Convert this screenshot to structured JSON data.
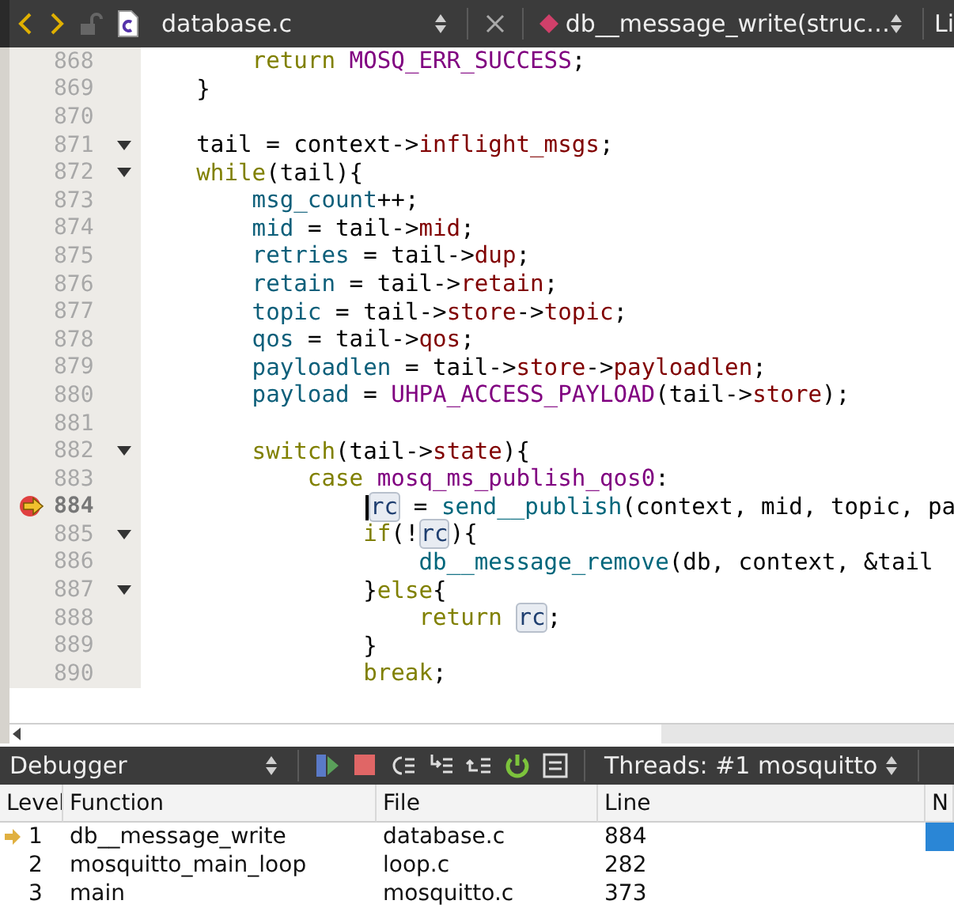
{
  "editor_toolbar": {
    "file": "database.c",
    "function": "db__message_write(struc…",
    "cut_label": "Li"
  },
  "code": [
    {
      "number": "868",
      "fold": false,
      "current": false,
      "tokens": [
        {
          "kind": "kw",
          "text": "        return"
        },
        {
          "kind": "macro",
          "text": " MOSQ_ERR_SUCCESS"
        },
        {
          "kind": "plain",
          "text": ";"
        }
      ]
    },
    {
      "number": "869",
      "fold": false,
      "current": false,
      "tokens": [
        {
          "kind": "plain",
          "text": "    }"
        }
      ]
    },
    {
      "number": "870",
      "fold": false,
      "current": false
    },
    {
      "number": "871",
      "fold": true,
      "current": false,
      "tokens": [
        {
          "kind": "plain",
          "text": "    tail = context->"
        },
        {
          "kind": "field",
          "text": "inflight_msgs"
        },
        {
          "kind": "plain",
          "text": ";"
        }
      ]
    },
    {
      "number": "872",
      "fold": true,
      "current": false,
      "tokens": [
        {
          "kind": "kw",
          "text": "    while"
        },
        {
          "kind": "plain",
          "text": "(tail){"
        }
      ]
    },
    {
      "number": "873",
      "fold": false,
      "current": false,
      "tokens": [
        {
          "kind": "var",
          "text": "        msg_count"
        },
        {
          "kind": "plain",
          "text": "++;"
        }
      ]
    },
    {
      "number": "874",
      "fold": false,
      "current": false,
      "tokens": [
        {
          "kind": "var",
          "text": "        mid"
        },
        {
          "kind": "plain",
          "text": " = tail->"
        },
        {
          "kind": "field",
          "text": "mid"
        },
        {
          "kind": "plain",
          "text": ";"
        }
      ]
    },
    {
      "number": "875",
      "fold": false,
      "current": false,
      "tokens": [
        {
          "kind": "var",
          "text": "        retries"
        },
        {
          "kind": "plain",
          "text": " = tail->"
        },
        {
          "kind": "field",
          "text": "dup"
        },
        {
          "kind": "plain",
          "text": ";"
        }
      ]
    },
    {
      "number": "876",
      "fold": false,
      "current": false,
      "tokens": [
        {
          "kind": "var",
          "text": "        retain"
        },
        {
          "kind": "plain",
          "text": " = tail->"
        },
        {
          "kind": "field",
          "text": "retain"
        },
        {
          "kind": "plain",
          "text": ";"
        }
      ]
    },
    {
      "number": "877",
      "fold": false,
      "current": false,
      "tokens": [
        {
          "kind": "var",
          "text": "        topic"
        },
        {
          "kind": "plain",
          "text": " = tail->"
        },
        {
          "kind": "field",
          "text": "store"
        },
        {
          "kind": "plain",
          "text": "->"
        },
        {
          "kind": "field",
          "text": "topic"
        },
        {
          "kind": "plain",
          "text": ";"
        }
      ]
    },
    {
      "number": "878",
      "fold": false,
      "current": false,
      "tokens": [
        {
          "kind": "var",
          "text": "        qos"
        },
        {
          "kind": "plain",
          "text": " = tail->"
        },
        {
          "kind": "field",
          "text": "qos"
        },
        {
          "kind": "plain",
          "text": ";"
        }
      ]
    },
    {
      "number": "879",
      "fold": false,
      "current": false,
      "tokens": [
        {
          "kind": "var",
          "text": "        payloadlen"
        },
        {
          "kind": "plain",
          "text": " = tail->"
        },
        {
          "kind": "field",
          "text": "store"
        },
        {
          "kind": "plain",
          "text": "->"
        },
        {
          "kind": "field",
          "text": "payloadlen"
        },
        {
          "kind": "plain",
          "text": ";"
        }
      ]
    },
    {
      "number": "880",
      "fold": false,
      "current": false,
      "tokens": [
        {
          "kind": "var",
          "text": "        payload"
        },
        {
          "kind": "plain",
          "text": " = "
        },
        {
          "kind": "macro",
          "text": "UHPA_ACCESS_PAYLOAD"
        },
        {
          "kind": "plain",
          "text": "(tail->"
        },
        {
          "kind": "field",
          "text": "store"
        },
        {
          "kind": "plain",
          "text": ");"
        }
      ]
    },
    {
      "number": "881",
      "fold": false,
      "current": false
    },
    {
      "number": "882",
      "fold": true,
      "current": false,
      "tokens": [
        {
          "kind": "kw",
          "text": "        switch"
        },
        {
          "kind": "plain",
          "text": "(tail->"
        },
        {
          "kind": "field",
          "text": "state"
        },
        {
          "kind": "plain",
          "text": "){"
        }
      ]
    },
    {
      "number": "883",
      "fold": false,
      "current": false,
      "tokens": [
        {
          "kind": "kw",
          "text": "            case"
        },
        {
          "kind": "macro",
          "text": " mosq_ms_publish_qos0"
        },
        {
          "kind": "plain",
          "text": ":"
        }
      ]
    },
    {
      "number": "884",
      "fold": false,
      "current": true,
      "tokens": [
        {
          "kind": "ref",
          "text": "rc"
        },
        {
          "kind": "plain",
          "text": " = "
        },
        {
          "kind": "func",
          "text": "send__publish"
        },
        {
          "kind": "plain",
          "text": "(context, mid, topic, pa"
        }
      ]
    },
    {
      "number": "885",
      "fold": true,
      "current": false,
      "tokens": [
        {
          "kind": "kw",
          "text": "                if"
        },
        {
          "kind": "plain",
          "text": "(!"
        },
        {
          "kind": "ref",
          "text": "rc"
        },
        {
          "kind": "plain",
          "text": "){"
        }
      ]
    },
    {
      "number": "886",
      "fold": false,
      "current": false,
      "tokens": [
        {
          "kind": "func",
          "text": "                    db__message_remove"
        },
        {
          "kind": "plain",
          "text": "(db, context, &tail"
        }
      ]
    },
    {
      "number": "887",
      "fold": true,
      "current": false,
      "tokens": [
        {
          "kind": "plain",
          "text": "                }"
        },
        {
          "kind": "kw",
          "text": "else"
        },
        {
          "kind": "plain",
          "text": "{"
        }
      ]
    },
    {
      "number": "888",
      "fold": false,
      "current": false,
      "tokens": [
        {
          "kind": "kw",
          "text": "                    return "
        },
        {
          "kind": "ref",
          "text": "rc"
        },
        {
          "kind": "plain",
          "text": ";"
        }
      ]
    },
    {
      "number": "889",
      "fold": false,
      "current": false,
      "tokens": [
        {
          "kind": "plain",
          "text": "                }"
        }
      ]
    },
    {
      "number": "890",
      "fold": false,
      "current": false,
      "tokens": [
        {
          "kind": "kw",
          "text": "                break"
        },
        {
          "kind": "plain",
          "text": ";"
        }
      ]
    }
  ],
  "debugger_toolbar": {
    "view": "Debugger",
    "threads": "Threads: #1 mosquitto"
  },
  "stack": {
    "columns": [
      "Level",
      "Function",
      "File",
      "Line",
      "N"
    ],
    "rows": [
      {
        "current": true,
        "cells": [
          "1",
          "db__message_write",
          "database.c",
          "884"
        ]
      },
      {
        "current": false,
        "cells": [
          "2",
          "mosquitto_main_loop",
          "loop.c",
          "282"
        ]
      },
      {
        "current": false,
        "cells": [
          "3",
          "main",
          "mosquitto.c",
          "373"
        ]
      }
    ]
  }
}
